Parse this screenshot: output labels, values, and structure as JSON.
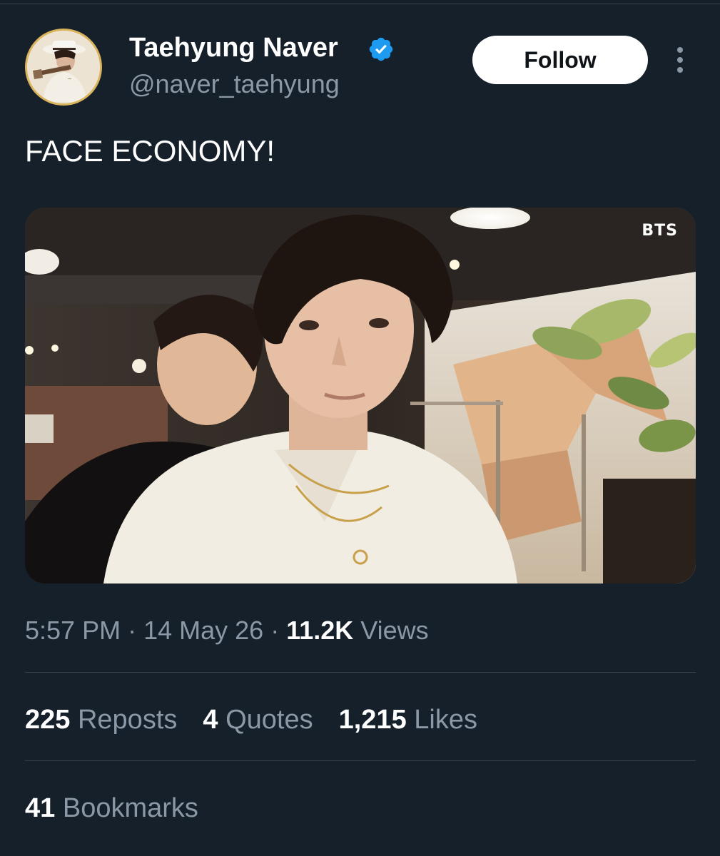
{
  "author": {
    "display_name": "Taehyung Naver",
    "handle": "@naver_taehyung",
    "verified": true,
    "verified_color": "#1d9bf0"
  },
  "actions": {
    "follow_label": "Follow"
  },
  "tweet": {
    "text": "FACE ECONOMY!",
    "media_watermark": "BTS",
    "time": "5:57 PM",
    "date": "14 May 26",
    "views_count": "11.2K",
    "views_label": "Views"
  },
  "stats": {
    "reposts_count": "225",
    "reposts_label": "Reposts",
    "quotes_count": "4",
    "quotes_label": "Quotes",
    "likes_count": "1,215",
    "likes_label": "Likes",
    "bookmarks_count": "41",
    "bookmarks_label": "Bookmarks"
  },
  "colors": {
    "background": "#15202b",
    "text_primary": "#ffffff",
    "text_secondary": "#8b98a5",
    "divider": "#38444d"
  },
  "icons": {
    "verified": "verified-badge-icon",
    "more": "more-vertical-icon"
  }
}
